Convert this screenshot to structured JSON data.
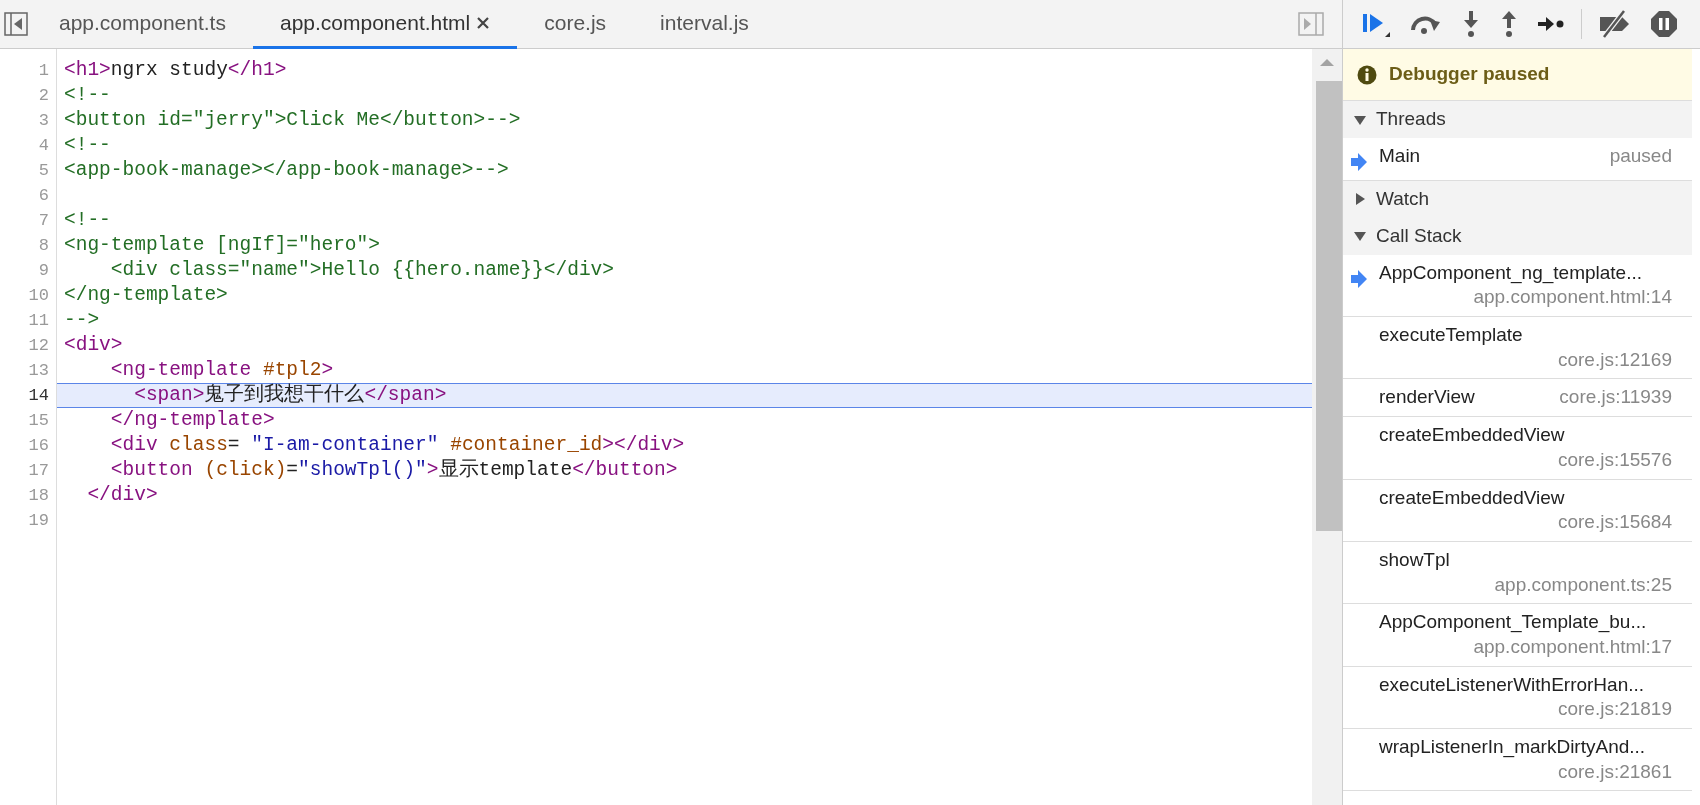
{
  "tabs": [
    {
      "label": "app.component.ts",
      "selected": false,
      "closable": false
    },
    {
      "label": "app.component.html",
      "selected": true,
      "closable": true
    },
    {
      "label": "core.js",
      "selected": false,
      "closable": false
    },
    {
      "label": "interval.js",
      "selected": false,
      "closable": false
    }
  ],
  "editor": {
    "lines": [
      {
        "number": "1",
        "current": false,
        "tokens": [
          {
            "kind": "tag",
            "text": "<h1>"
          },
          {
            "kind": "text",
            "text": "ngrx study"
          },
          {
            "kind": "tag",
            "text": "</h1>"
          }
        ]
      },
      {
        "number": "2",
        "current": false,
        "tokens": [
          {
            "kind": "comment",
            "text": "<!--"
          }
        ]
      },
      {
        "number": "3",
        "current": false,
        "tokens": [
          {
            "kind": "comment",
            "text": "<button id=\"jerry\">Click Me</button>-->"
          }
        ]
      },
      {
        "number": "4",
        "current": false,
        "tokens": [
          {
            "kind": "comment",
            "text": "<!--"
          }
        ]
      },
      {
        "number": "5",
        "current": false,
        "tokens": [
          {
            "kind": "comment",
            "text": "<app-book-manage></app-book-manage>-->"
          }
        ]
      },
      {
        "number": "6",
        "current": false
      },
      {
        "number": "7",
        "current": false,
        "tokens": [
          {
            "kind": "comment",
            "text": "<!--"
          }
        ]
      },
      {
        "number": "8",
        "current": false,
        "tokens": [
          {
            "kind": "comment",
            "text": "<ng-template [ngIf]=\"hero\">"
          }
        ]
      },
      {
        "number": "9",
        "current": false,
        "tokens": [
          {
            "kind": "comment",
            "text": "    <div class=\"name\">Hello {{hero.name}}</div>"
          }
        ]
      },
      {
        "number": "10",
        "current": false,
        "tokens": [
          {
            "kind": "comment",
            "text": "</ng-template>"
          }
        ]
      },
      {
        "number": "11",
        "current": false,
        "tokens": [
          {
            "kind": "comment",
            "text": "-->"
          }
        ]
      },
      {
        "number": "12",
        "current": false,
        "tokens": [
          {
            "kind": "tag",
            "text": "<div>"
          }
        ]
      },
      {
        "number": "13",
        "current": false,
        "tokens": [
          {
            "kind": "tag",
            "text": "    <ng-template"
          },
          {
            "kind": "attr",
            "text": " #tpl2"
          },
          {
            "kind": "tag",
            "text": ">"
          }
        ]
      },
      {
        "number": "14",
        "current": true,
        "tokens": [
          {
            "kind": "tag",
            "text": "      <span>"
          },
          {
            "kind": "text",
            "text": "鬼子到我想干什么"
          },
          {
            "kind": "tag",
            "text": "</span>"
          }
        ]
      },
      {
        "number": "15",
        "current": false,
        "tokens": [
          {
            "kind": "tag",
            "text": "    </ng-template>"
          }
        ]
      },
      {
        "number": "16",
        "current": false,
        "tokens": [
          {
            "kind": "tag",
            "text": "    <div"
          },
          {
            "kind": "attr",
            "text": " class"
          },
          {
            "kind": "text",
            "text": "= "
          },
          {
            "kind": "string",
            "text": "\"I-am-container\""
          },
          {
            "kind": "attr",
            "text": " #container_id"
          },
          {
            "kind": "tag",
            "text": "></div>"
          }
        ]
      },
      {
        "number": "17",
        "current": false,
        "tokens": [
          {
            "kind": "tag",
            "text": "    <button"
          },
          {
            "kind": "attr",
            "text": " (click)"
          },
          {
            "kind": "text",
            "text": "="
          },
          {
            "kind": "string",
            "text": "\"showTpl()\""
          },
          {
            "kind": "tag",
            "text": ">"
          },
          {
            "kind": "text",
            "text": "显示template"
          },
          {
            "kind": "tag",
            "text": "</button>"
          }
        ]
      },
      {
        "number": "18",
        "current": false,
        "tokens": [
          {
            "kind": "tag",
            "text": "  </div>"
          }
        ]
      },
      {
        "number": "19",
        "current": false
      }
    ]
  },
  "debugger": {
    "banner": "Debugger paused",
    "sections": [
      {
        "title": "Threads",
        "expanded": true,
        "kind": "threads",
        "items": [
          {
            "name": "Main",
            "status": "paused",
            "current": true
          }
        ]
      },
      {
        "title": "Watch",
        "expanded": false
      },
      {
        "title": "Call Stack",
        "expanded": true,
        "kind": "stack",
        "items": [
          {
            "name": "AppComponent_ng_template...",
            "location": "app.component.html:14",
            "current": true
          },
          {
            "name": "executeTemplate",
            "location": "core.js:12169",
            "current": false
          },
          {
            "name": "renderView",
            "location": "core.js:11939",
            "current": false
          },
          {
            "name": "createEmbeddedView",
            "location": "core.js:15576",
            "current": false
          },
          {
            "name": "createEmbeddedView",
            "location": "core.js:15684",
            "current": false
          },
          {
            "name": "showTpl",
            "location": "app.component.ts:25",
            "current": false
          },
          {
            "name": "AppComponent_Template_bu...",
            "location": "app.component.html:17",
            "current": false
          },
          {
            "name": "executeListenerWithErrorHan...",
            "location": "core.js:21819",
            "current": false
          },
          {
            "name": "wrapListenerIn_markDirtyAnd...",
            "location": "core.js:21861",
            "current": false
          }
        ]
      }
    ]
  }
}
